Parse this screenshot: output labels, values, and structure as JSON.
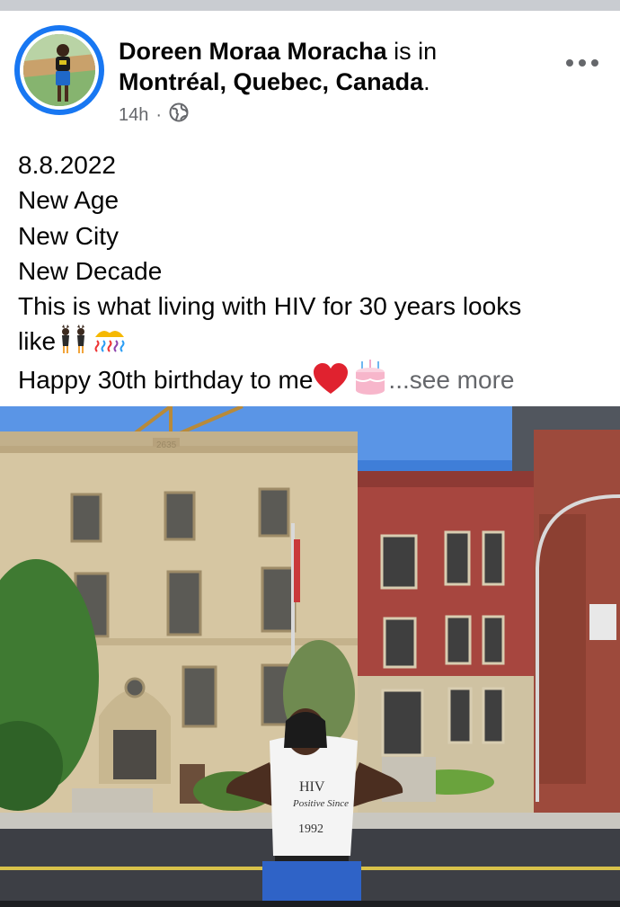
{
  "post": {
    "author": "Doreen Moraa Moracha",
    "connector": "is in",
    "location": "Montréal, Quebec, Canada",
    "location_suffix": ".",
    "time": "14h",
    "separator": "·",
    "privacy_icon": "globe-icon",
    "text_lines": [
      "8.8.2022",
      "New Age",
      "New City",
      "New Decade",
      "This is what living with HIV for 30 years looks",
      "like",
      "Happy 30th birthday to me"
    ],
    "see_more": "...see more",
    "photo": {
      "shirt_line1": "HIV",
      "shirt_line2": "Positive Since",
      "shirt_line3": "1992",
      "building_sign": "2635"
    }
  },
  "colors": {
    "accent": "#1877f2",
    "secondary_text": "#65676b",
    "primary_text": "#050505"
  }
}
